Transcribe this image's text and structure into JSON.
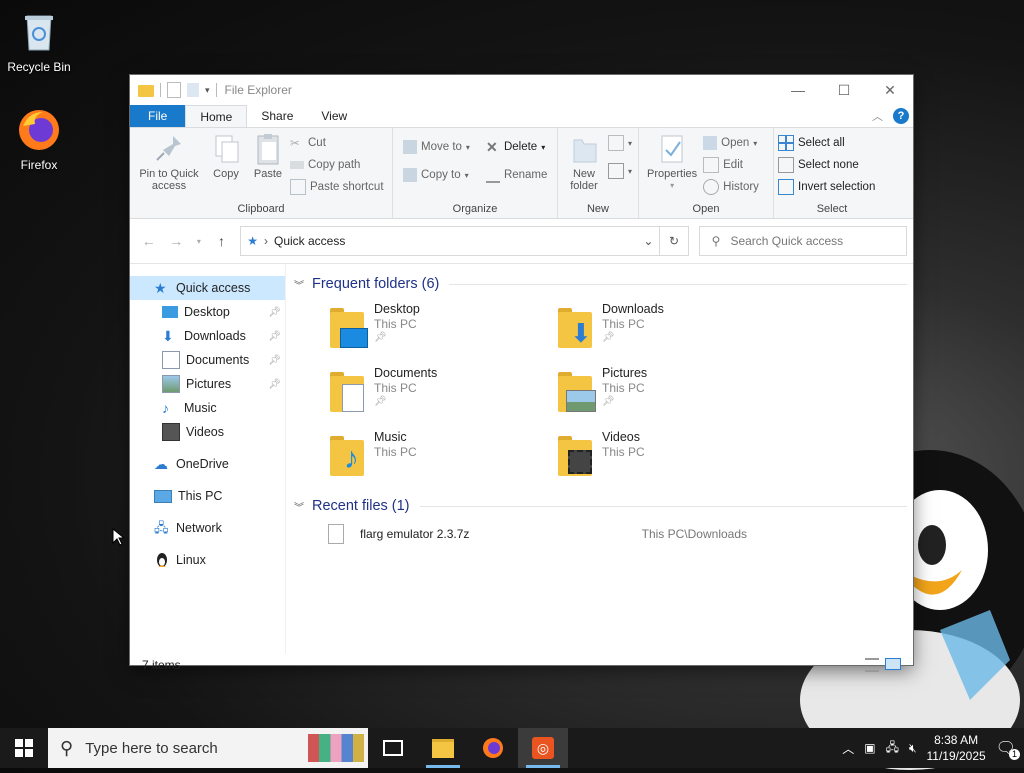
{
  "desktop": {
    "icons": [
      {
        "label": "Recycle Bin"
      },
      {
        "label": "Firefox"
      }
    ]
  },
  "window": {
    "title": "File Explorer",
    "tabs": {
      "file": "File",
      "home": "Home",
      "share": "Share",
      "view": "View"
    },
    "ribbon": {
      "clipboard": {
        "pin_label": "Pin to Quick access",
        "copy_label": "Copy",
        "paste_label": "Paste",
        "cut_label": "Cut",
        "copy_path_label": "Copy path",
        "paste_shortcut_label": "Paste shortcut",
        "group_label": "Clipboard"
      },
      "organize": {
        "move_to_label": "Move to",
        "copy_to_label": "Copy to",
        "delete_label": "Delete",
        "rename_label": "Rename",
        "group_label": "Organize"
      },
      "new": {
        "new_folder_label": "New folder",
        "group_label": "New"
      },
      "open": {
        "properties_label": "Properties",
        "open_label": "Open",
        "edit_label": "Edit",
        "history_label": "History",
        "group_label": "Open"
      },
      "select": {
        "select_all_label": "Select all",
        "select_none_label": "Select none",
        "invert_label": "Invert selection",
        "group_label": "Select"
      }
    },
    "address": {
      "path": "Quick access",
      "search_placeholder": "Search Quick access"
    },
    "nav_pane": {
      "items": [
        {
          "label": "Quick access"
        },
        {
          "label": "Desktop"
        },
        {
          "label": "Downloads"
        },
        {
          "label": "Documents"
        },
        {
          "label": "Pictures"
        },
        {
          "label": "Music"
        },
        {
          "label": "Videos"
        },
        {
          "label": "OneDrive"
        },
        {
          "label": "This PC"
        },
        {
          "label": "Network"
        },
        {
          "label": "Linux"
        }
      ]
    },
    "frequent": {
      "header": "Frequent folders (6)",
      "folders": [
        {
          "name": "Desktop",
          "location": "This PC"
        },
        {
          "name": "Downloads",
          "location": "This PC"
        },
        {
          "name": "Documents",
          "location": "This PC"
        },
        {
          "name": "Pictures",
          "location": "This PC"
        },
        {
          "name": "Music",
          "location": "This PC"
        },
        {
          "name": "Videos",
          "location": "This PC"
        }
      ]
    },
    "recent": {
      "header": "Recent files (1)",
      "files": [
        {
          "name": "flarg emulator 2.3.7z",
          "path": "This PC\\Downloads"
        }
      ]
    },
    "status": {
      "items": "7 items"
    }
  },
  "taskbar": {
    "search_placeholder": "Type here to search",
    "time": "8:38 AM",
    "date": "11/19/2025",
    "notification_count": "1"
  },
  "colors": {
    "accent": "#1979ca",
    "selection": "#cce8ff",
    "folder": "#f4c542"
  }
}
